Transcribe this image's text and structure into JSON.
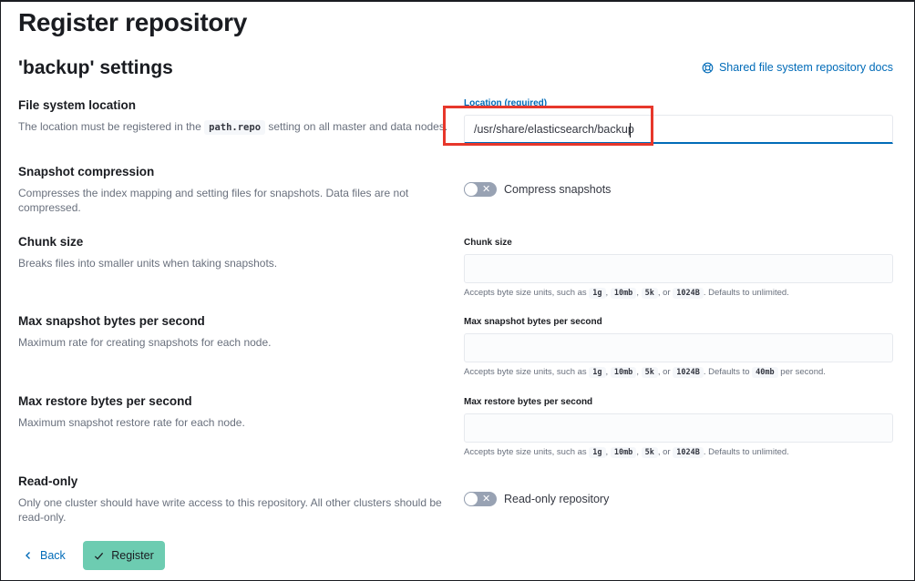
{
  "page": {
    "title": "Register repository"
  },
  "settings": {
    "title": "'backup' settings",
    "docs_link": "Shared file system repository docs"
  },
  "sections": {
    "location": {
      "title": "File system location",
      "desc_before": "The location must be registered in the",
      "desc_code": "path.repo",
      "desc_after": "setting on all master and data nodes.",
      "label": "Location (required)",
      "value": "/usr/share/elasticsearch/backup"
    },
    "compression": {
      "title": "Snapshot compression",
      "desc": "Compresses the index mapping and setting files for snapshots. Data files are not compressed.",
      "toggle_label": "Compress snapshots",
      "toggle_on": false
    },
    "chunk": {
      "title": "Chunk size",
      "desc": "Breaks files into smaller units when taking snapshots.",
      "label": "Chunk size",
      "value": "",
      "help_prefix": "Accepts byte size units, such as",
      "units": [
        "1g",
        "10mb",
        "5k",
        "1024B"
      ],
      "help_suffix": "Defaults to unlimited."
    },
    "max_snapshot": {
      "title": "Max snapshot bytes per second",
      "desc": "Maximum rate for creating snapshots for each node.",
      "label": "Max snapshot bytes per second",
      "value": "",
      "help_prefix": "Accepts byte size units, such as",
      "units": [
        "1g",
        "10mb",
        "5k",
        "1024B"
      ],
      "help_mid": "Defaults to",
      "default_code": "40mb",
      "help_suffix": "per second."
    },
    "max_restore": {
      "title": "Max restore bytes per second",
      "desc": "Maximum snapshot restore rate for each node.",
      "label": "Max restore bytes per second",
      "value": "",
      "help_prefix": "Accepts byte size units, such as",
      "units": [
        "1g",
        "10mb",
        "5k",
        "1024B"
      ],
      "help_suffix": "Defaults to unlimited."
    },
    "readonly": {
      "title": "Read-only",
      "desc": "Only one cluster should have write access to this repository. All other clusters should be read-only.",
      "toggle_label": "Read-only repository",
      "toggle_on": false
    }
  },
  "footer": {
    "back_label": "Back",
    "register_label": "Register"
  },
  "colors": {
    "accent": "#006bb8",
    "primary_button": "#6dccb1",
    "highlight": "#e7372b"
  },
  "icons": {
    "docs": "help-circle-icon",
    "back": "chevron-left-icon",
    "register": "check-icon",
    "toggle_off": "cross-icon"
  }
}
